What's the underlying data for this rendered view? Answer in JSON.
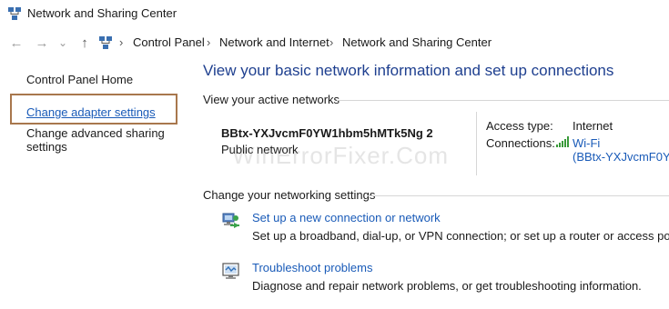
{
  "window": {
    "title": "Network and Sharing Center",
    "icon": "network-center-icon"
  },
  "nav": {
    "back_icon": "←",
    "forward_icon": "→",
    "dropdown_icon": "⌄",
    "up_icon": "↑",
    "separator": "›",
    "breadcrumbs": [
      "Control Panel",
      "Network and Internet",
      "Network and Sharing Center"
    ]
  },
  "sidebar": {
    "home": "Control Panel Home",
    "adapter": "Change adapter settings",
    "sharing_line1": "Change advanced sharing",
    "sharing_line2": "settings"
  },
  "main": {
    "heading": "View your basic network information and set up connections",
    "active_networks_label": "View your active networks",
    "network_name": "BBtx-YXJvcmF0YW1hbm5hMTk5Ng 2",
    "network_type": "Public network",
    "access_type_label": "Access type:",
    "access_type_value": "Internet",
    "connections_label": "Connections:",
    "connection_name": "Wi-Fi",
    "connection_ssid": "(BBtx-YXJvcmF0YW",
    "change_settings_label": "Change your networking settings",
    "tasks": [
      {
        "title": "Set up a new connection or network",
        "desc": "Set up a broadband, dial-up, or VPN connection; or set up a router or access point."
      },
      {
        "title": "Troubleshoot problems",
        "desc": "Diagnose and repair network problems, or get troubleshooting information."
      }
    ]
  },
  "watermark": "WinErrorFixer.Com",
  "colors": {
    "link": "#1a5bb8",
    "heading": "#1e3f8f",
    "highlight": "#a8774d"
  }
}
